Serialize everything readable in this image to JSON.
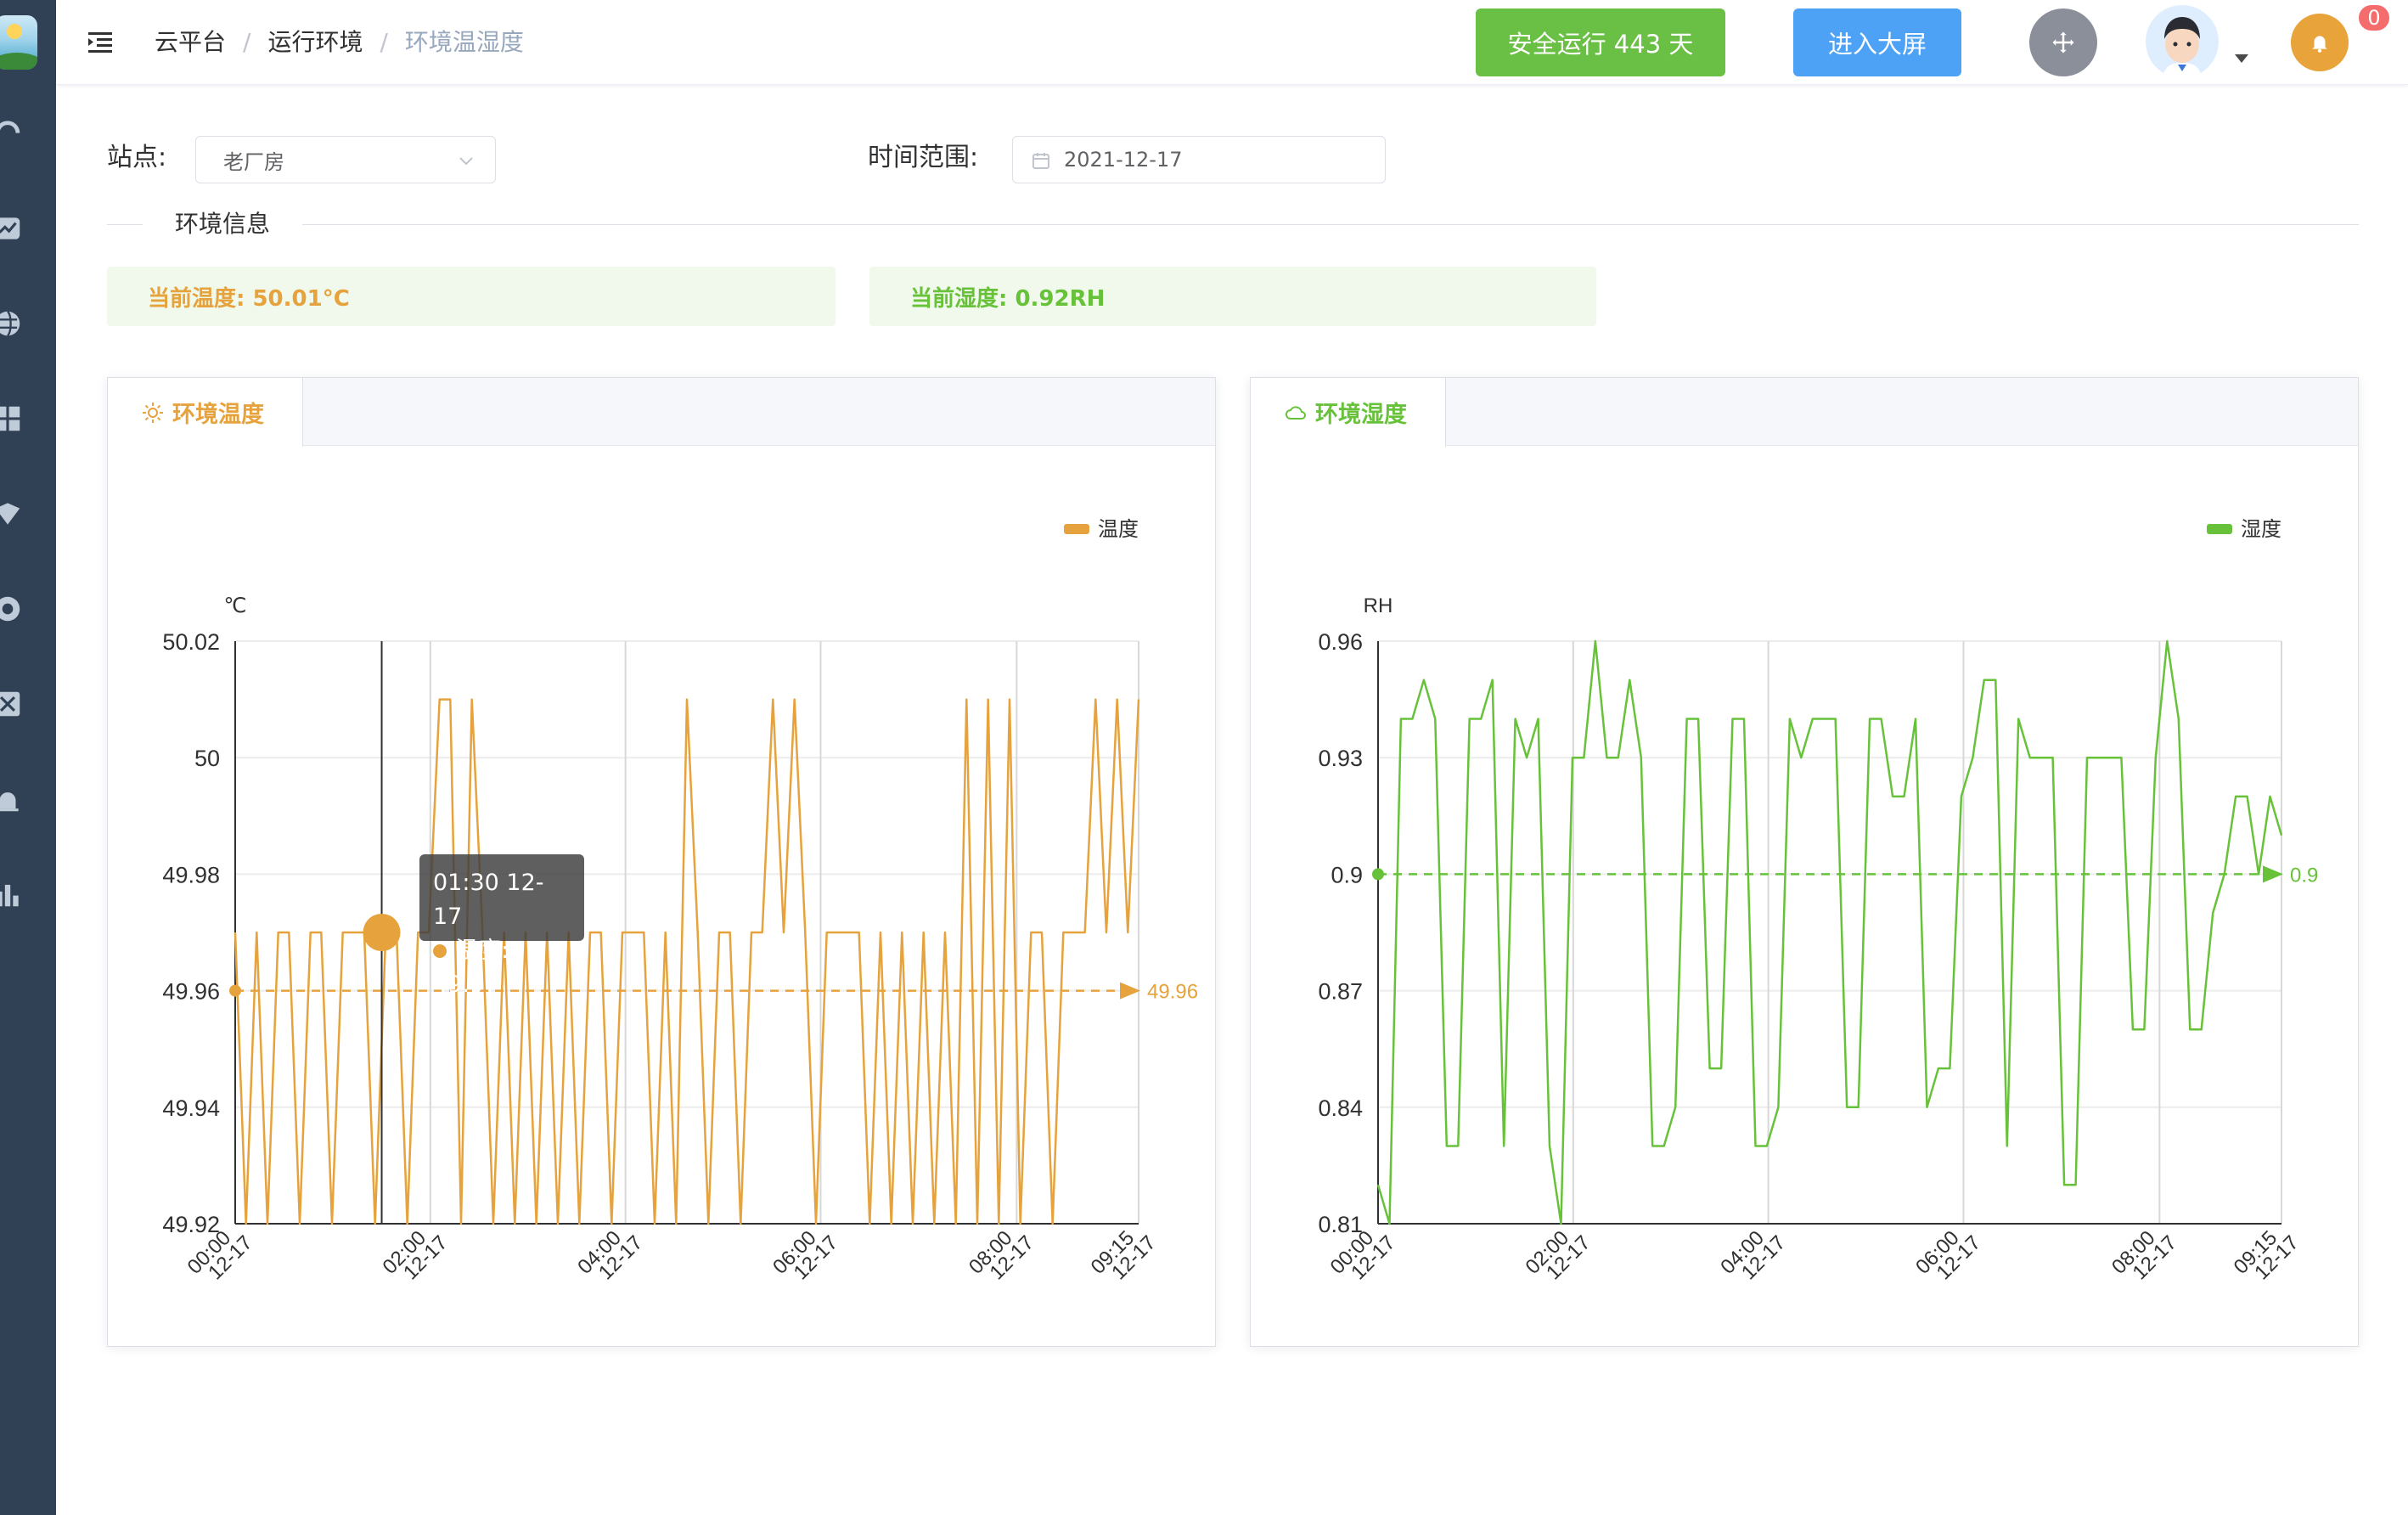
{
  "topbar": {
    "breadcrumb": [
      "云平台",
      "运行环境",
      "环境温湿度"
    ],
    "safety_button": "安全运行 443 天",
    "bigscreen_button": "进入大屏",
    "notification_count": "0"
  },
  "filters": {
    "station_label": "站点:",
    "station_value": "老厂房",
    "time_label": "时间范围:",
    "time_value": "2021-12-17"
  },
  "section": {
    "title": "环境信息"
  },
  "info": {
    "temperature": "当前温度: 50.01°C",
    "humidity": "当前湿度: 0.92RH"
  },
  "temp_card": {
    "tab_label": "环境温度"
  },
  "hum_card": {
    "tab_label": "环境湿度"
  },
  "tooltip": {
    "time": "01:30 12-17",
    "series_label": "温度: 49.97"
  },
  "colors": {
    "temperature": "#e6a23c",
    "humidity": "#67c23a",
    "primary": "#4ea2f6",
    "success": "#6ac045"
  },
  "chart_data": [
    {
      "type": "line",
      "title": "",
      "xlabel": "",
      "ylabel": "℃",
      "ylim": [
        49.92,
        50.02
      ],
      "yticks": [
        "50.02",
        "50",
        "49.98",
        "49.96",
        "49.94",
        "49.92"
      ],
      "xticks": [
        "00:00\n12-17",
        "02:00\n12-17",
        "04:00\n12-17",
        "06:00\n12-17",
        "08:00\n12-17",
        "09:15\n12-17"
      ],
      "legend": "top-right",
      "average_label": "49.96",
      "series": [
        {
          "name": "温度",
          "x_start": "00:00",
          "x_end": "09:15",
          "values": [
            49.97,
            49.92,
            49.97,
            49.92,
            49.97,
            49.97,
            49.92,
            49.97,
            49.97,
            49.92,
            49.97,
            49.97,
            49.97,
            49.92,
            49.97,
            49.97,
            49.92,
            49.97,
            49.97,
            50.01,
            50.01,
            49.92,
            50.01,
            49.97,
            49.92,
            49.97,
            49.92,
            49.97,
            49.92,
            49.97,
            49.92,
            49.97,
            49.92,
            49.97,
            49.97,
            49.92,
            49.97,
            49.97,
            49.97,
            49.92,
            49.97,
            49.92,
            50.01,
            49.97,
            49.92,
            49.97,
            49.97,
            49.92,
            49.97,
            49.97,
            50.01,
            49.97,
            50.01,
            49.97,
            49.92,
            49.97,
            49.97,
            49.97,
            49.97,
            49.92,
            49.97,
            49.92,
            49.97,
            49.92,
            49.97,
            49.92,
            49.97,
            49.92,
            50.01,
            49.92,
            50.01,
            49.92,
            50.01,
            49.92,
            49.97,
            49.97,
            49.92,
            49.97,
            49.97,
            49.97,
            50.01,
            49.97,
            50.01,
            49.97,
            50.01
          ]
        }
      ]
    },
    {
      "type": "line",
      "title": "",
      "xlabel": "",
      "ylabel": "RH",
      "ylim": [
        0.81,
        0.96
      ],
      "yticks": [
        "0.96",
        "0.93",
        "0.9",
        "0.87",
        "0.84",
        "0.81"
      ],
      "xticks": [
        "00:00\n12-17",
        "02:00\n12-17",
        "04:00\n12-17",
        "06:00\n12-17",
        "08:00\n12-17",
        "09:15\n12-17"
      ],
      "legend": "top-right",
      "average_label": "0.9",
      "series": [
        {
          "name": "湿度",
          "x_start": "00:00",
          "x_end": "09:15",
          "values": [
            0.82,
            0.81,
            0.94,
            0.94,
            0.95,
            0.94,
            0.83,
            0.83,
            0.94,
            0.94,
            0.95,
            0.83,
            0.94,
            0.93,
            0.94,
            0.83,
            0.81,
            0.93,
            0.93,
            0.96,
            0.93,
            0.93,
            0.95,
            0.93,
            0.83,
            0.83,
            0.84,
            0.94,
            0.94,
            0.85,
            0.85,
            0.94,
            0.94,
            0.83,
            0.83,
            0.84,
            0.94,
            0.93,
            0.94,
            0.94,
            0.94,
            0.84,
            0.84,
            0.94,
            0.94,
            0.92,
            0.92,
            0.94,
            0.84,
            0.85,
            0.85,
            0.92,
            0.93,
            0.95,
            0.95,
            0.83,
            0.94,
            0.93,
            0.93,
            0.93,
            0.82,
            0.82,
            0.93,
            0.93,
            0.93,
            0.93,
            0.86,
            0.86,
            0.93,
            0.96,
            0.94,
            0.86,
            0.86,
            0.89,
            0.9,
            0.92,
            0.92,
            0.9,
            0.92,
            0.91
          ]
        }
      ]
    }
  ]
}
